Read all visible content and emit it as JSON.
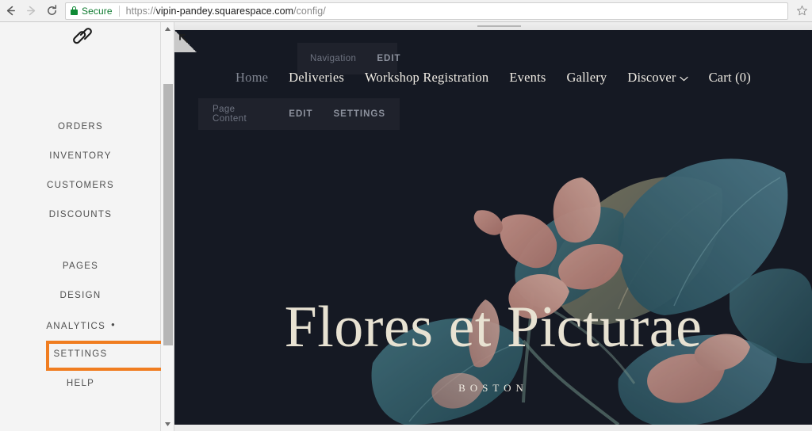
{
  "browser": {
    "back_icon": "arrow-left-icon",
    "forward_icon": "arrow-right-icon",
    "reload_icon": "reload-icon",
    "security_label": "Secure",
    "lock_icon": "lock-icon",
    "url_scheme": "https://",
    "url_host": "vipin-pandey.squarespace.com",
    "url_path": "/config/",
    "url_full": "https://vipin-pandey.squarespace.com/config/",
    "bookmark_icon": "star-icon",
    "secure_color": "#0f7b30"
  },
  "sidebar": {
    "logo_icon": "squarespace-logo-icon",
    "commerce_items": [
      {
        "label": "ORDERS",
        "name": "sidebar-item-orders"
      },
      {
        "label": "INVENTORY",
        "name": "sidebar-item-inventory"
      },
      {
        "label": "CUSTOMERS",
        "name": "sidebar-item-customers"
      },
      {
        "label": "DISCOUNTS",
        "name": "sidebar-item-discounts"
      }
    ],
    "site_items": [
      {
        "label": "PAGES",
        "name": "sidebar-item-pages"
      },
      {
        "label": "DESIGN",
        "name": "sidebar-item-design"
      },
      {
        "label": "ANALYTICS",
        "name": "sidebar-item-analytics",
        "dot": true
      },
      {
        "label": "SETTINGS",
        "name": "sidebar-item-settings",
        "highlighted": true
      },
      {
        "label": "HELP",
        "name": "sidebar-item-help"
      }
    ],
    "highlight_color": "#f07d20",
    "scrollbar": {
      "up_icon": "scroll-up-arrow-icon",
      "down_icon": "scroll-down-arrow-icon"
    }
  },
  "preview": {
    "collapse_icon": "collapse-arrow-icon",
    "resize_handle": "drag-handle",
    "site_nav": [
      {
        "label": "Home",
        "name": "site-nav-home",
        "muted": true
      },
      {
        "label": "Deliveries",
        "name": "site-nav-deliveries",
        "muted": false
      },
      {
        "label": "Workshop Registration",
        "name": "site-nav-workshop-registration",
        "muted": false
      },
      {
        "label": "Events",
        "name": "site-nav-events",
        "muted": false
      },
      {
        "label": "Gallery",
        "name": "site-nav-gallery",
        "muted": false
      },
      {
        "label": "Discover",
        "name": "site-nav-discover",
        "muted": false,
        "chevron": true
      },
      {
        "label": "Cart (0)",
        "name": "site-nav-cart",
        "muted": false
      }
    ],
    "navigation_pill": {
      "label": "Navigation",
      "edit_label": "EDIT"
    },
    "page_content_pill": {
      "label": "Page Content",
      "edit_label": "EDIT",
      "settings_label": "SETTINGS"
    },
    "hero": {
      "title": "Flores et Picturae",
      "subtitle": "BOSTON",
      "background_color": "#151924",
      "title_color": "#e8e2d2",
      "petal_color": "#d8968c",
      "leaf_color": "#3b6d7a"
    }
  }
}
